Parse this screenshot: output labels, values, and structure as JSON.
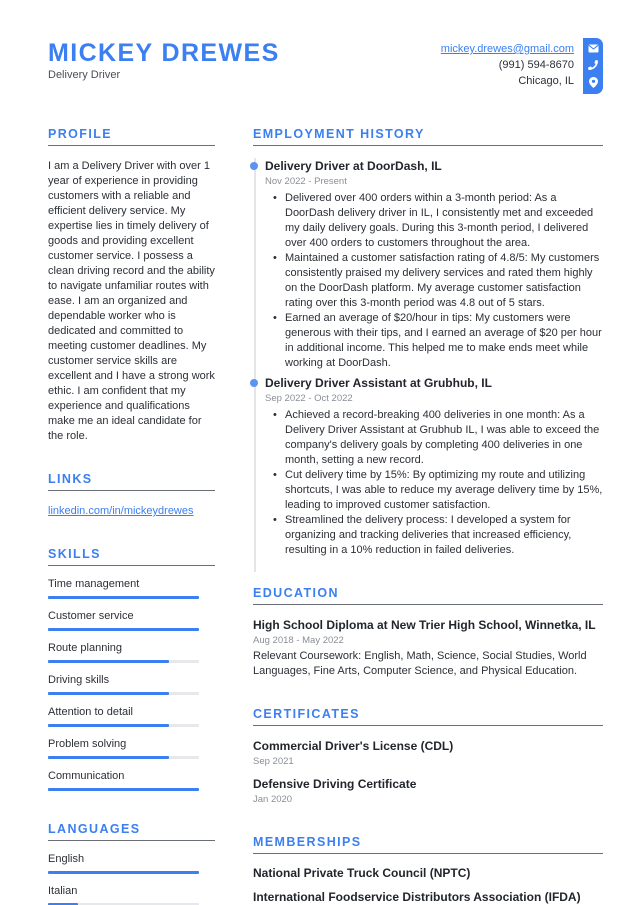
{
  "header": {
    "name": "MICKEY DREWES",
    "title": "Delivery Driver"
  },
  "contact": {
    "email": "mickey.drewes@gmail.com",
    "phone": "(991) 594-8670",
    "location": "Chicago, IL",
    "icons": [
      "envelope-icon",
      "phone-icon",
      "map-pin-icon"
    ]
  },
  "profile": {
    "heading": "PROFILE",
    "text": "I am a Delivery Driver with over 1 year of experience in providing customers with a reliable and efficient delivery service. My expertise lies in timely delivery of goods and providing excellent customer service. I possess a clean driving record and the ability to navigate unfamiliar routes with ease. I am an organized and dependable worker who is dedicated and committed to meeting customer deadlines. My customer service skills are excellent and I have a strong work ethic. I am confident that my experience and qualifications make me an ideal candidate for the role."
  },
  "links": {
    "heading": "LINKS",
    "items": [
      {
        "label": "linkedin.com/in/mickeydrewes"
      }
    ]
  },
  "skills": {
    "heading": "SKILLS",
    "items": [
      {
        "label": "Time management",
        "level": 1.0
      },
      {
        "label": "Customer service",
        "level": 1.0
      },
      {
        "label": "Route planning",
        "level": 0.8
      },
      {
        "label": "Driving skills",
        "level": 0.8
      },
      {
        "label": "Attention to detail",
        "level": 0.8
      },
      {
        "label": "Problem solving",
        "level": 0.8
      },
      {
        "label": "Communication",
        "level": 1.0
      }
    ]
  },
  "languages": {
    "heading": "LANGUAGES",
    "items": [
      {
        "label": "English",
        "level": 1.0
      },
      {
        "label": "Italian",
        "level": 0.2
      }
    ]
  },
  "employment": {
    "heading": "EMPLOYMENT HISTORY",
    "jobs": [
      {
        "title": "Delivery Driver at DoorDash, IL",
        "dates": "Nov 2022 - Present",
        "bullets": [
          "Delivered over 400 orders within a 3-month period: As a DoorDash delivery driver in IL, I consistently met and exceeded my daily delivery goals. During this 3-month period, I delivered over 400 orders to customers throughout the area.",
          "Maintained a customer satisfaction rating of 4.8/5: My customers consistently praised my delivery services and rated them highly on the DoorDash platform. My average customer satisfaction rating over this 3-month period was 4.8 out of 5 stars.",
          "Earned an average of $20/hour in tips: My customers were generous with their tips, and I earned an average of $20 per hour in additional income. This helped me to make ends meet while working at DoorDash."
        ]
      },
      {
        "title": "Delivery Driver Assistant at Grubhub, IL",
        "dates": "Sep 2022 - Oct 2022",
        "bullets": [
          "Achieved a record-breaking 400 deliveries in one month: As a Delivery Driver Assistant at Grubhub IL, I was able to exceed the company's delivery goals by completing 400 deliveries in one month, setting a new record.",
          "Cut delivery time by 15%: By optimizing my route and utilizing shortcuts, I was able to reduce my average delivery time by 15%, leading to improved customer satisfaction.",
          "Streamlined the delivery process: I developed a system for organizing and tracking deliveries that increased efficiency, resulting in a 10% reduction in failed deliveries."
        ]
      }
    ]
  },
  "education": {
    "heading": "EDUCATION",
    "items": [
      {
        "title": "High School Diploma at New Trier High School, Winnetka, IL",
        "dates": "Aug 2018 - May 2022",
        "description": "Relevant Coursework: English, Math, Science, Social Studies, World Languages, Fine Arts, Computer Science, and Physical Education."
      }
    ]
  },
  "certificates": {
    "heading": "CERTIFICATES",
    "items": [
      {
        "title": "Commercial Driver's License (CDL)",
        "date": "Sep 2021"
      },
      {
        "title": "Defensive Driving Certificate",
        "date": "Jan 2020"
      }
    ]
  },
  "memberships": {
    "heading": "MEMBERSHIPS",
    "items": [
      "National Private Truck Council (NPTC)",
      "International Foodservice Distributors Association (IFDA)"
    ]
  },
  "colors": {
    "accent": "#3b7ff0",
    "text": "#2b2f36",
    "muted": "#8a8f96",
    "track": "#e6e8eb"
  }
}
